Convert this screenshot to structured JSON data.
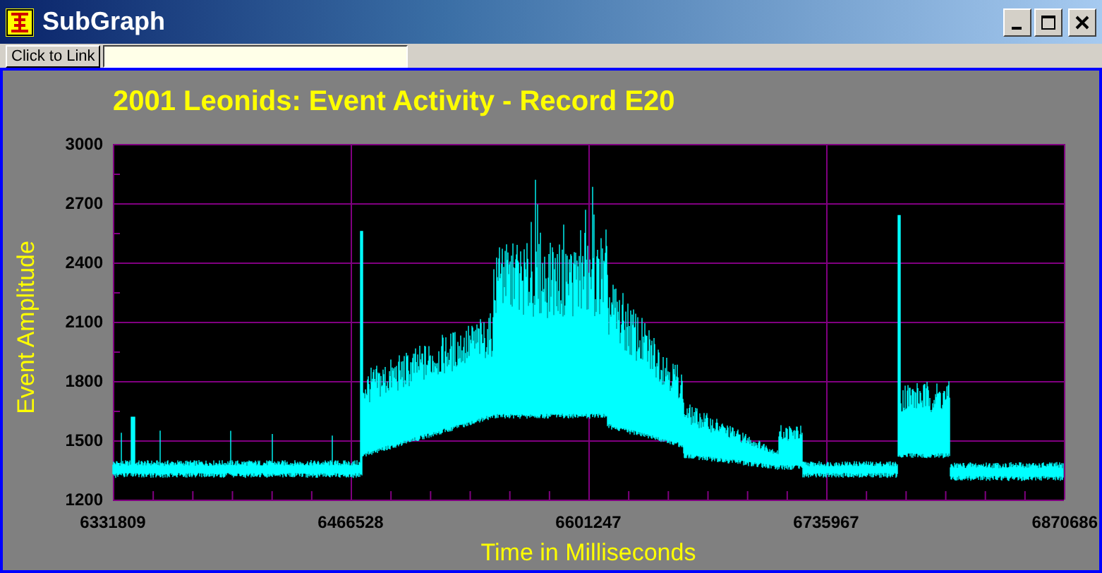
{
  "window": {
    "title": "SubGraph"
  },
  "toolbar": {
    "link_button": "Click to Link"
  },
  "chart": {
    "title": "2001 Leonids: Event Activity - Record E20",
    "ylabel": "Event Amplitude",
    "xlabel": "Time in Milliseconds",
    "yticks": [
      "3000",
      "2700",
      "2400",
      "2100",
      "1800",
      "1500",
      "1200"
    ],
    "xticks": [
      "6331809",
      "6466528",
      "6601247",
      "6735967",
      "6870686"
    ]
  }
}
